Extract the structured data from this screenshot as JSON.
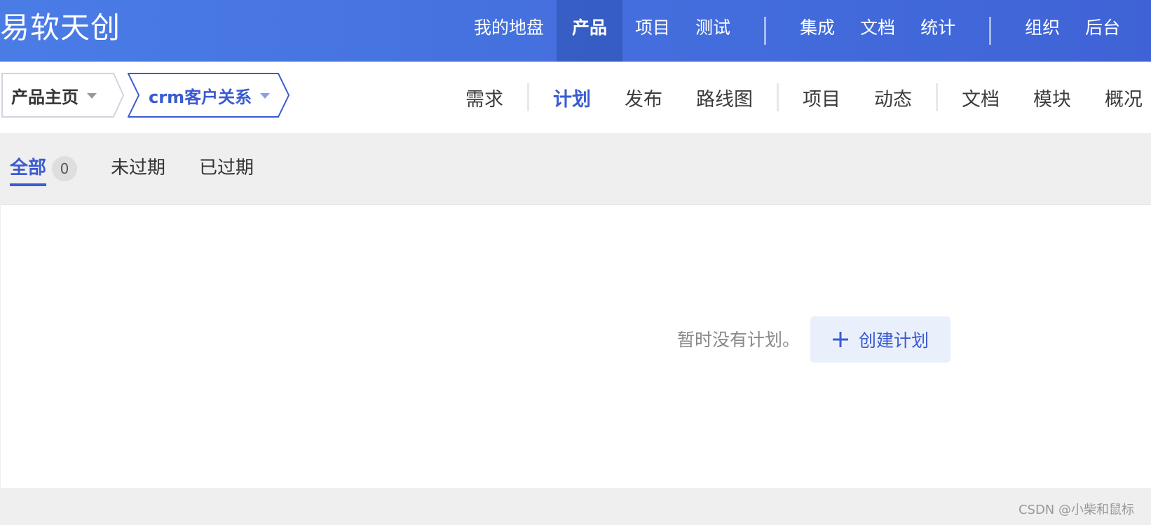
{
  "brand": {
    "name": "易软天创"
  },
  "top_nav": {
    "items": [
      "我的地盘",
      "产品",
      "项目",
      "测试",
      "集成",
      "文档",
      "统计",
      "组织",
      "后台"
    ],
    "active": "产品"
  },
  "breadcrumb": {
    "home_label": "产品主页",
    "product_label": "crm客户关系"
  },
  "sub_nav": {
    "items": [
      "需求",
      "计划",
      "发布",
      "路线图",
      "项目",
      "动态",
      "文档",
      "模块",
      "概况"
    ],
    "active": "计划"
  },
  "filter_tabs": {
    "all_label": "全部",
    "all_count": "0",
    "unexpired_label": "未过期",
    "expired_label": "已过期",
    "active": "全部"
  },
  "empty_state": {
    "message": "暂时没有计划。",
    "create_button_label": "创建计划"
  },
  "watermark": "CSDN @小柴和鼠标",
  "colors": {
    "topbar_start": "#4a7ce6",
    "topbar_end": "#3f63d6",
    "accent": "#3a5bd1",
    "page_background": "#efefef",
    "button_background": "#e9effb"
  },
  "icons": [
    "chevron-down-icon",
    "plus-icon"
  ]
}
